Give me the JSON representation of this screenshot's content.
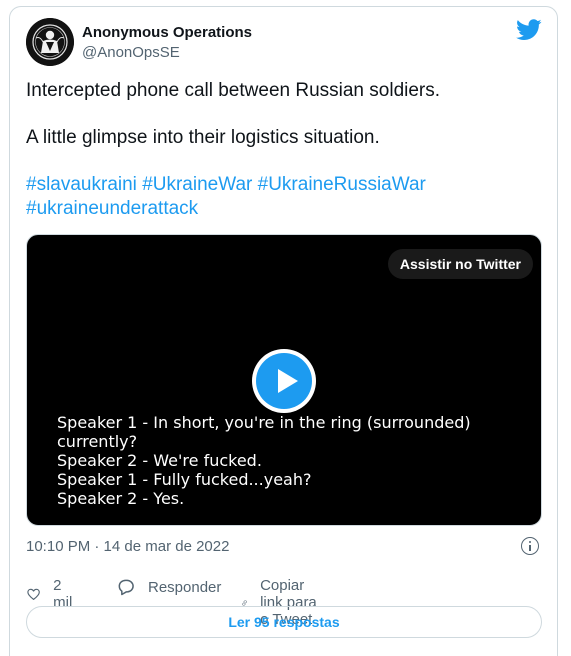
{
  "author": {
    "name": "Anonymous Operations",
    "handle": "@AnonOpsSE"
  },
  "tweet": {
    "line1": "Intercepted phone call between Russian soldiers.",
    "line2": "A little glimpse into their logistics situation.",
    "hashtags_line1": [
      "#slavaukraini",
      "#UkraineWar",
      "#UkraineRussiaWar"
    ],
    "hashtags_line2": [
      "#ukraineunderattack"
    ]
  },
  "media": {
    "watch_label": "Assistir no Twitter",
    "subtitles": [
      "Speaker 1 - In short, you're in the ring (surrounded)",
      "currently?",
      "Speaker 2 - We're fucked.",
      "Speaker 1 - Fully fucked...yeah?",
      "Speaker 2 - Yes."
    ]
  },
  "timestamp": "10:10 PM · 14 de mar de 2022",
  "actions": {
    "likes": "2 mil",
    "reply_label": "Responder",
    "copy_link_label": "Copiar link para o Tweet"
  },
  "read_replies_label": "Ler 95 respostas",
  "colors": {
    "accent": "#1d9bf0",
    "text": "#0f1419",
    "muted": "#536471",
    "border": "#cfd9de"
  }
}
